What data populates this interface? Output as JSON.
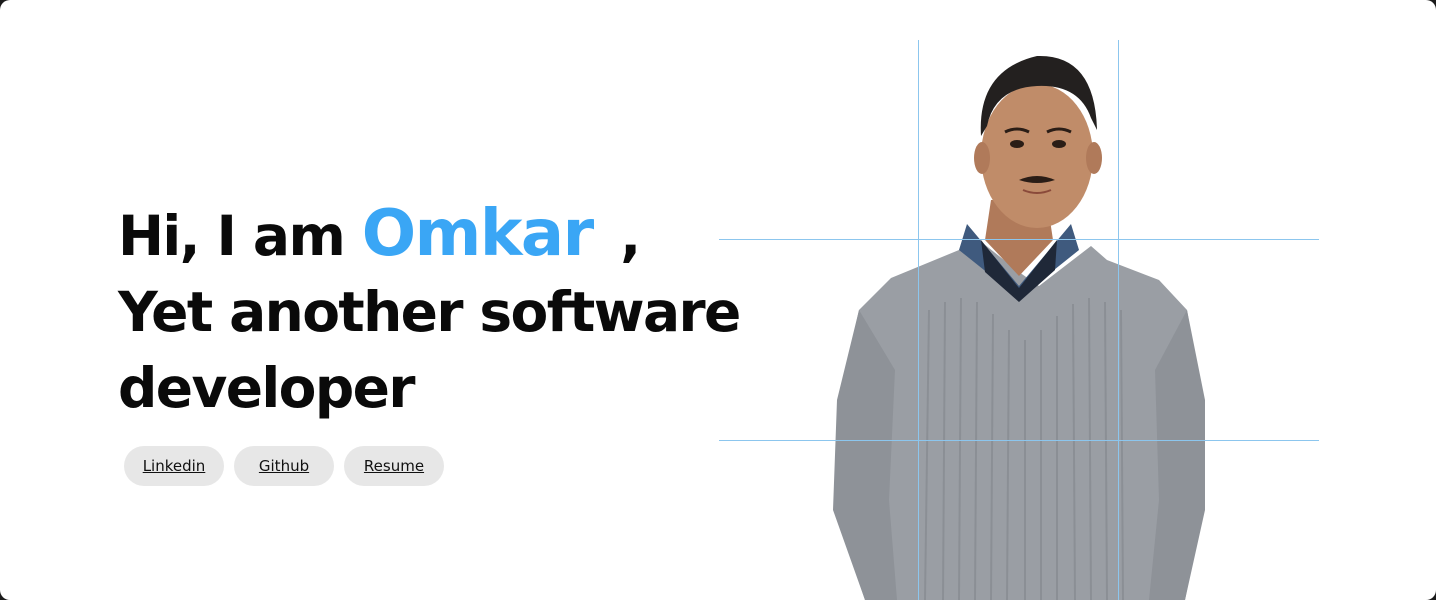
{
  "hero": {
    "greeting": "Hi, I am",
    "name": "Omkar",
    "comma": ",",
    "line2": "Yet another software",
    "line3": "developer"
  },
  "links": [
    {
      "label": "Linkedin"
    },
    {
      "label": "Github"
    },
    {
      "label": "Resume"
    }
  ],
  "colors": {
    "accent": "#3aa6f5",
    "pill_bg": "#e7e7e7",
    "grid_line": "#8cc6ee"
  },
  "portrait": {
    "icon": "person-photo"
  }
}
